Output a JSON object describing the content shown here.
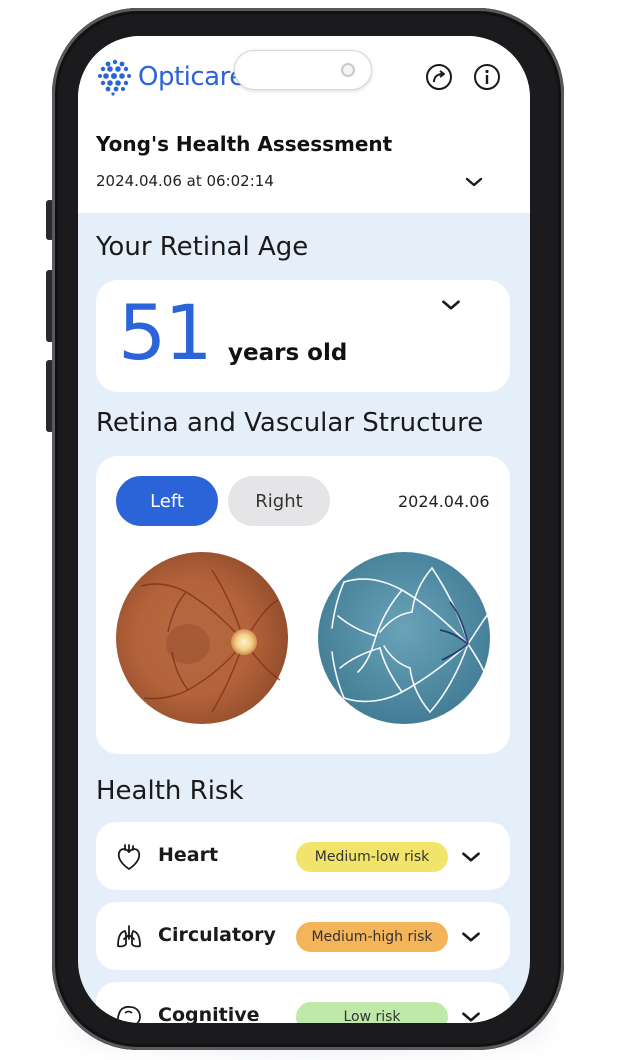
{
  "app": {
    "brand": "Opticare AI",
    "brand_color": "#2b63d9",
    "icons": [
      "share-icon",
      "info-icon"
    ]
  },
  "assessment": {
    "title": "Yong's Health Assessment",
    "datetime": "2024.04.06 at 06:02:14"
  },
  "retinal_age": {
    "section_title": "Your Retinal Age",
    "value": "51",
    "unit": "years old"
  },
  "retina": {
    "section_title": "Retina and Vascular Structure",
    "tabs": [
      {
        "label": "Left",
        "selected": true
      },
      {
        "label": "Right",
        "selected": false
      }
    ],
    "date": "2024.04.06"
  },
  "health_risk": {
    "section_title": "Health Risk",
    "items": [
      {
        "label": "Heart",
        "risk": "Medium-low risk",
        "badge_color": "#f2e46a",
        "icon": "heart-icon"
      },
      {
        "label": "Circulatory",
        "risk": "Medium-high risk",
        "badge_color": "#f3b45a",
        "icon": "lungs-icon"
      },
      {
        "label": "Cognitive",
        "risk": "Low risk",
        "badge_color": "#bfe9a8",
        "icon": "brain-icon"
      }
    ]
  }
}
